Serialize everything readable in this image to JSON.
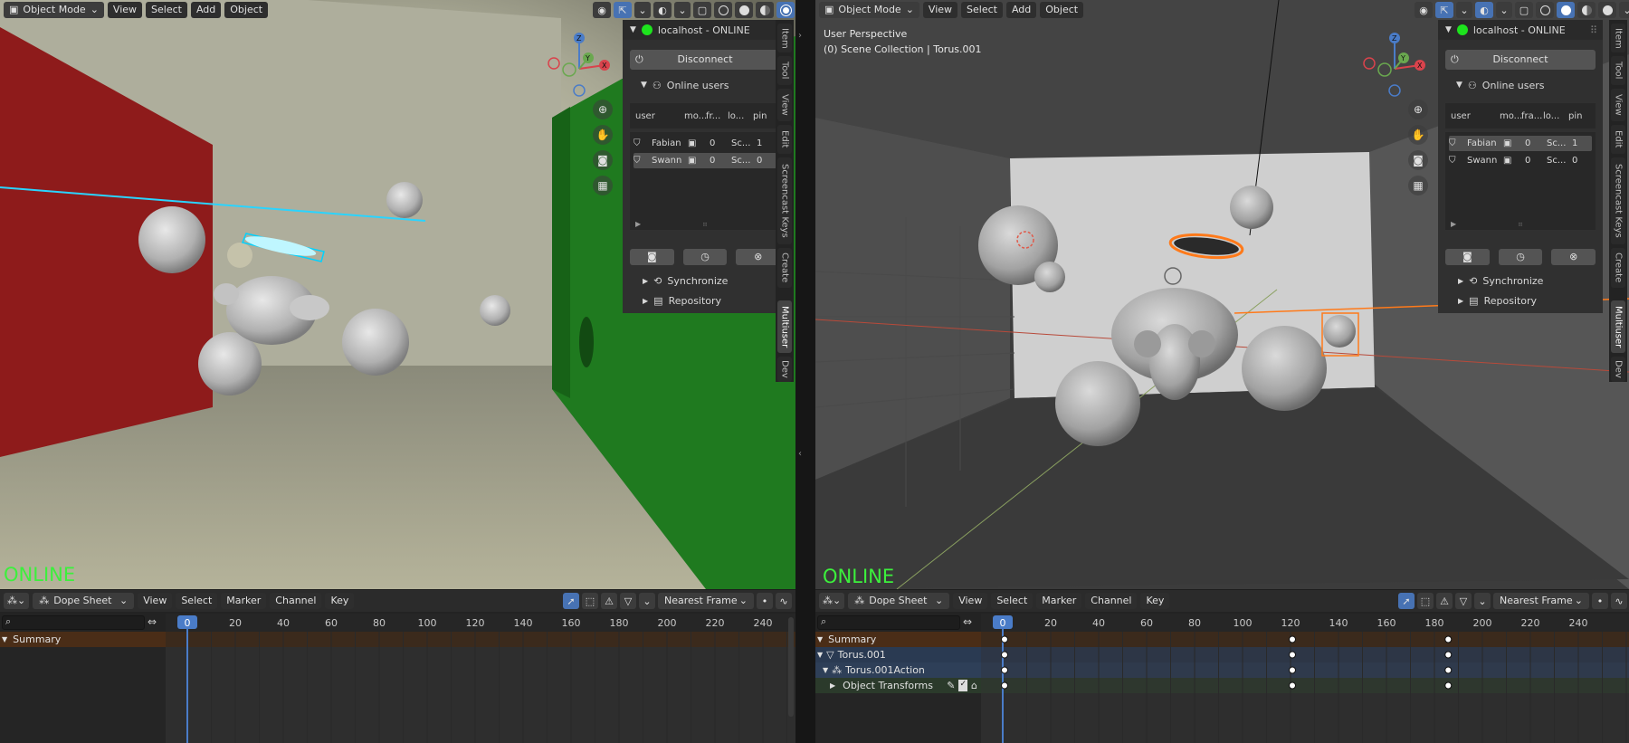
{
  "left": {
    "header": {
      "mode": "Object Mode",
      "menus": [
        "View",
        "Select",
        "Add",
        "Object"
      ]
    },
    "overlay_text": "ONLINE",
    "panel": {
      "title": "localhost - ONLINE",
      "disconnect": "Disconnect",
      "online_users": "Online users",
      "columns": [
        "user",
        "mo...",
        "fr...",
        "lo...",
        "pin"
      ],
      "users": [
        {
          "name": "Fabian",
          "frame": "0",
          "scene": "Sc...",
          "pin": "1"
        },
        {
          "name": "Swann",
          "frame": "0",
          "scene": "Sc...",
          "pin": "0"
        }
      ],
      "synchronize": "Synchronize",
      "repository": "Repository"
    },
    "tabs": [
      "Item",
      "Tool",
      "View",
      "Edit",
      "Screencast Keys",
      "Create",
      "Multiuser",
      "Dev"
    ],
    "dope": {
      "editor": "Dope Sheet",
      "menus": [
        "View",
        "Select",
        "Marker",
        "Channel",
        "Key"
      ],
      "snap": "Nearest Frame",
      "current_frame": "0",
      "ticks": [
        "20",
        "40",
        "60",
        "80",
        "100",
        "120",
        "140",
        "160",
        "180",
        "200",
        "220",
        "240"
      ],
      "channels": [
        "Summary"
      ]
    }
  },
  "right": {
    "header": {
      "mode": "Object Mode",
      "menus": [
        "View",
        "Select",
        "Add",
        "Object"
      ]
    },
    "viewport_title": "User Perspective",
    "viewport_subtitle": "(0) Scene Collection | Torus.001",
    "overlay_text": "ONLINE",
    "panel": {
      "title": "localhost - ONLINE",
      "disconnect": "Disconnect",
      "online_users": "Online users",
      "columns": [
        "user",
        "mo...",
        "fra...",
        "lo...",
        "pin"
      ],
      "users": [
        {
          "name": "Fabian",
          "frame": "0",
          "scene": "Sc...",
          "pin": "1"
        },
        {
          "name": "Swann",
          "frame": "0",
          "scene": "Sc...",
          "pin": "0"
        }
      ],
      "synchronize": "Synchronize",
      "repository": "Repository"
    },
    "tabs": [
      "Item",
      "Tool",
      "View",
      "Edit",
      "Screencast Keys",
      "Create",
      "Multiuser",
      "Dev"
    ],
    "dope": {
      "editor": "Dope Sheet",
      "menus": [
        "View",
        "Select",
        "Marker",
        "Channel",
        "Key"
      ],
      "snap": "Nearest Frame",
      "current_frame": "0",
      "ticks": [
        "20",
        "40",
        "60",
        "80",
        "100",
        "120",
        "140",
        "160",
        "180",
        "200",
        "220",
        "240"
      ],
      "channels": [
        "Summary",
        "Torus.001",
        "Torus.001Action",
        "Object Transforms"
      ],
      "keyframes": [
        0,
        120,
        185
      ]
    }
  },
  "colors": {
    "online": "#3cf03c",
    "active_button": "#4772b3",
    "playhead": "#4a7cc8",
    "selection_outline": "#ff7a1a",
    "active_outline": "#00d2ff"
  }
}
